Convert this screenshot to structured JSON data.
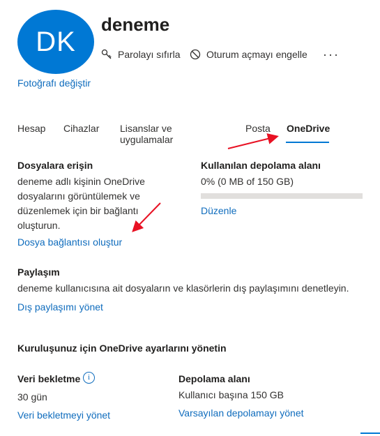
{
  "profile": {
    "initials": "DK",
    "name": "deneme",
    "change_photo": "Fotoğrafı değiştir",
    "actions": {
      "reset_password": "Parolayı sıfırla",
      "block_signin": "Oturum açmayı engelle",
      "more": "···"
    }
  },
  "tabs": [
    "Hesap",
    "Cihazlar",
    "Lisanslar ve uygulamalar",
    "Posta",
    "OneDrive"
  ],
  "active_tab": "OneDrive",
  "file_access": {
    "title": "Dosyalara erişin",
    "description": "deneme adlı kişinin OneDrive dosyalarını görüntülemek ve düzenlemek için bir bağlantı oluşturun.",
    "link": "Dosya bağlantısı oluştur"
  },
  "storage_used": {
    "title": "Kullanılan depolama alanı",
    "value": "0% (0 MB of 150 GB)",
    "percent": 0,
    "link": "Düzenle"
  },
  "sharing": {
    "title": "Paylaşım",
    "description": "deneme kullanıcısına ait dosyaların ve klasörlerin dış paylaşımını denetleyin.",
    "link": "Dış paylaşımı yönet"
  },
  "org_settings": {
    "title": "Kuruluşunuz için OneDrive ayarlarını yönetin",
    "retention": {
      "title": "Veri bekletme",
      "info": "i",
      "value": "30 gün",
      "link": "Veri bekletmeyi yönet"
    },
    "storage": {
      "title": "Depolama alanı",
      "value": "Kullanıcı başına 150 GB",
      "link": "Varsayılan depolamayı yönet"
    }
  },
  "colors": {
    "accent": "#0078d4",
    "link": "#0f6cbd",
    "annotation": "#e81123"
  }
}
